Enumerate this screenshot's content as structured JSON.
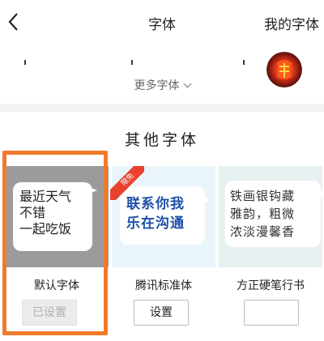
{
  "header": {
    "title": "字体",
    "my_fonts": "我的字体"
  },
  "more_fonts": "更多字体",
  "section": {
    "title": "其他字体"
  },
  "fonts": [
    {
      "preview_lines": [
        "最近天气",
        "不错",
        "一起吃饭"
      ],
      "name": "默认字体",
      "button": "已设置"
    },
    {
      "preview_lines": [
        "联系你我",
        "乐在沟通"
      ],
      "name": "腾讯标准体",
      "button": "设置",
      "badge": "限免"
    },
    {
      "preview_lines": [
        "铁画银钩藏",
        "雅韵，粗微",
        "浓淡漫馨香"
      ],
      "name": "方正硬笔行书",
      "button": ""
    }
  ],
  "colors": {
    "highlight": "#f07a2a",
    "badge": "#e8422f",
    "link_blue": "#1f4fa8"
  }
}
